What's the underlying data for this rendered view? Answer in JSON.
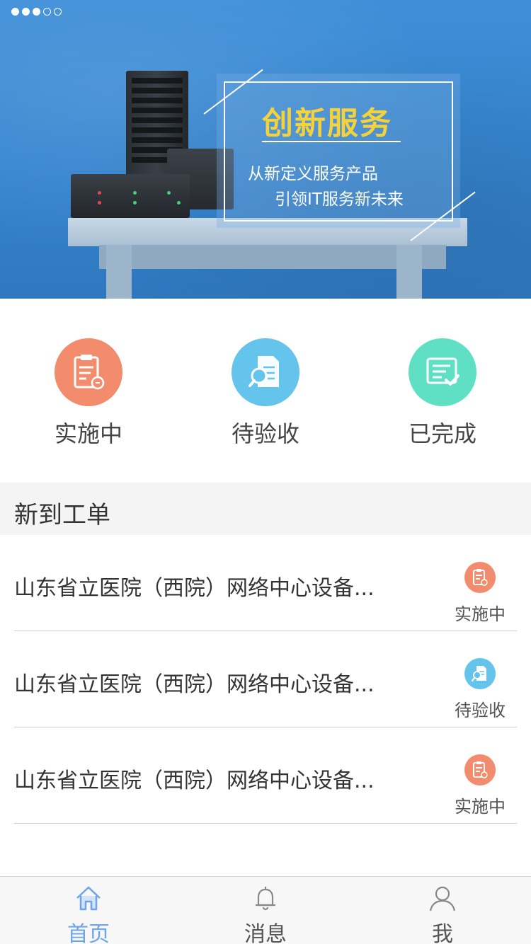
{
  "banner": {
    "title": "创新服务",
    "subtitle_line1": "从新定义服务产品",
    "subtitle_line2": "引领IT服务新未来",
    "carousel": {
      "total": 5,
      "active_count": 3
    }
  },
  "categories": [
    {
      "label": "实施中",
      "color": "#f28c6c",
      "icon": "clipboard-icon"
    },
    {
      "label": "待验收",
      "color": "#64c4ec",
      "icon": "document-search-icon"
    },
    {
      "label": "已完成",
      "color": "#5fe0c4",
      "icon": "checklist-done-icon"
    }
  ],
  "new_orders": {
    "title": "新到工单",
    "items": [
      {
        "title": "山东省立医院（西院）网络中心设备...",
        "status": "实施中",
        "status_color": "#f28c6c",
        "icon": "clipboard-icon"
      },
      {
        "title": "山东省立医院（西院）网络中心设备...",
        "status": "待验收",
        "status_color": "#64c4ec",
        "icon": "document-search-icon"
      },
      {
        "title": "山东省立医院（西院）网络中心设备...",
        "status": "实施中",
        "status_color": "#f28c6c",
        "icon": "clipboard-icon"
      }
    ]
  },
  "tabbar": {
    "items": [
      {
        "label": "首页",
        "icon": "home-icon",
        "active": true
      },
      {
        "label": "消息",
        "icon": "bell-icon",
        "active": false
      },
      {
        "label": "我",
        "icon": "user-icon",
        "active": false
      }
    ],
    "active_color": "#6fa4e8",
    "inactive_color": "#555555"
  }
}
